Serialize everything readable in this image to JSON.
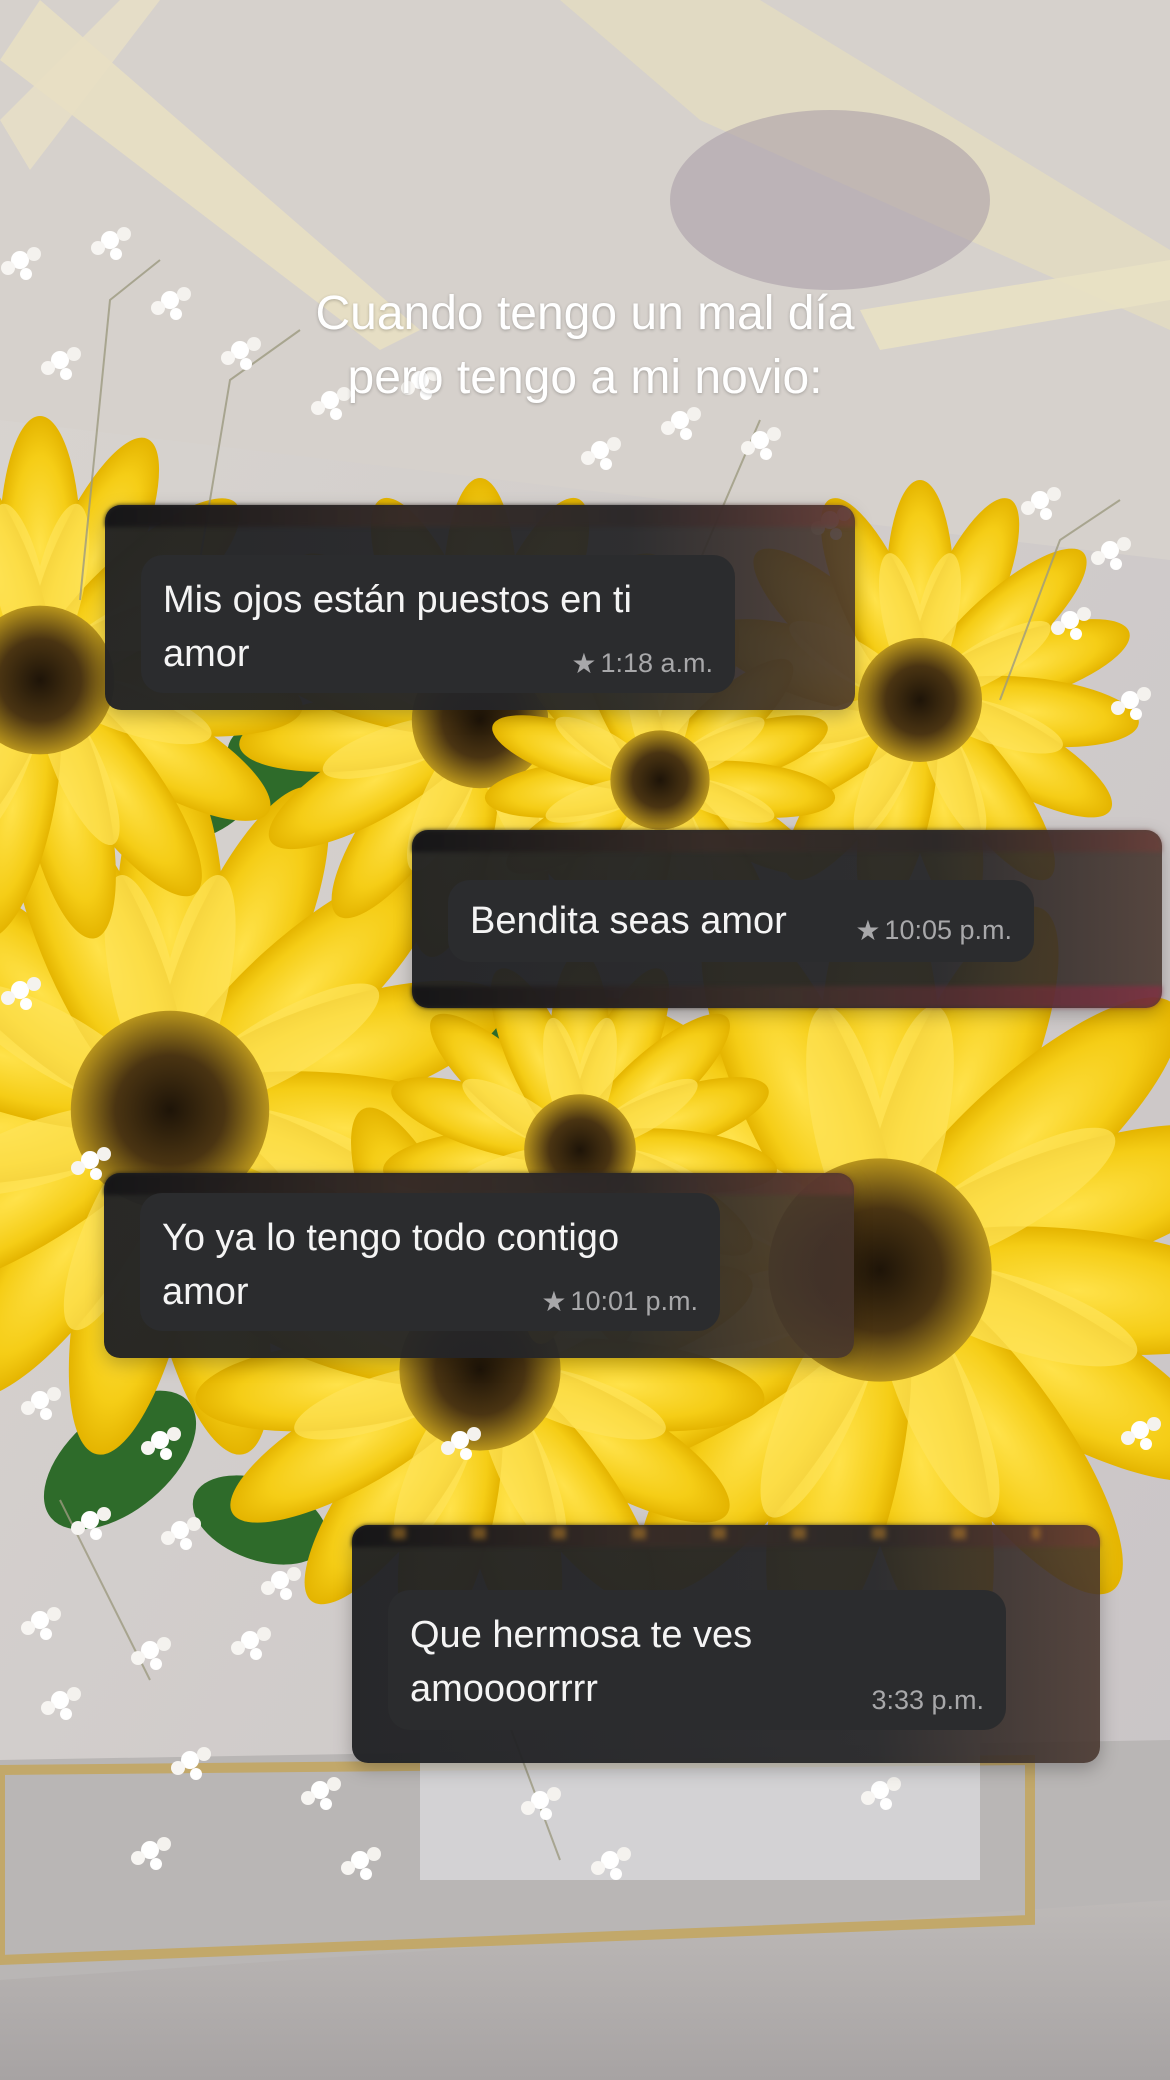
{
  "caption": {
    "line1": "Cuando tengo un mal día",
    "line2": "pero tengo a mi novio:"
  },
  "messages": [
    {
      "text": "Mis ojos están puestos en ti\namor",
      "time": "1:18 a.m.",
      "starred": true,
      "icon": "star-icon"
    },
    {
      "text": "Bendita seas amor",
      "time": "10:05 p.m.",
      "starred": true,
      "icon": "star-icon"
    },
    {
      "text": "Yo ya lo tengo todo contigo\namor",
      "time": "10:01 p.m.",
      "starred": true,
      "icon": "star-icon"
    },
    {
      "text": "Que hermosa te ves\namoooorrrr",
      "time": "3:33 p.m.",
      "starred": false
    }
  ],
  "colors": {
    "bubble": "#2b2c2e",
    "flower_yellow": "#f7d21c",
    "flower_center": "#3a2a10",
    "caption_text": "#ffffff",
    "time_text": "#a8a8aa"
  }
}
